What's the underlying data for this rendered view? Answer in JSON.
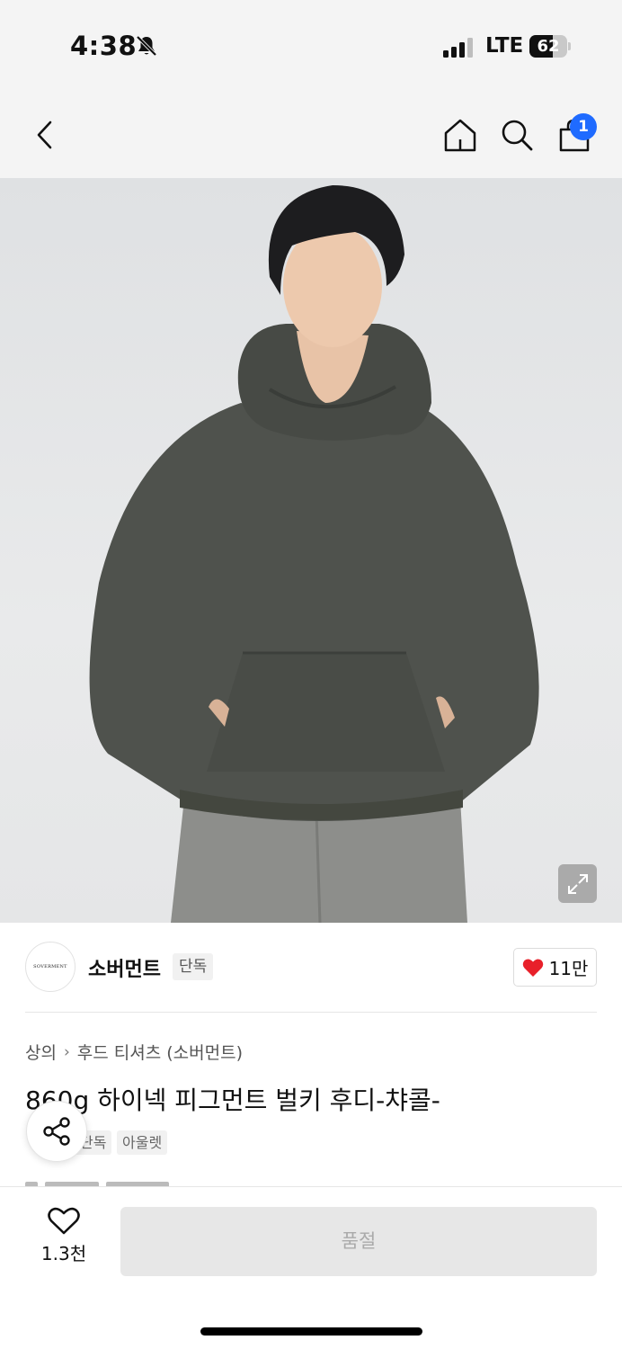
{
  "status_bar": {
    "time": "4:38",
    "network": "LTE",
    "battery": "62",
    "battery_level": 0.62
  },
  "header": {
    "back_icon": "chevron-left-icon",
    "home_icon": "home-icon",
    "search_icon": "search-icon",
    "cart_icon": "shopping-bag-icon",
    "cart_badge": "1"
  },
  "brand": {
    "logo_text": "SOVERMENT",
    "name": "소버먼트",
    "tag": "단독",
    "like_count": "11만"
  },
  "product": {
    "breadcrumb": [
      "상의",
      "후드 티셔츠 (소버먼트)"
    ],
    "title": "860g 하이넥 피그먼트 벌키 후디-챠콜-",
    "tags": [
      "단독",
      "아울렛"
    ]
  },
  "bottom_bar": {
    "wish_count": "1.3천",
    "soldout_label": "품절"
  },
  "colors": {
    "accent": "#1f6bff",
    "heart": "#e8202a",
    "hoodie": "#4f524d"
  }
}
